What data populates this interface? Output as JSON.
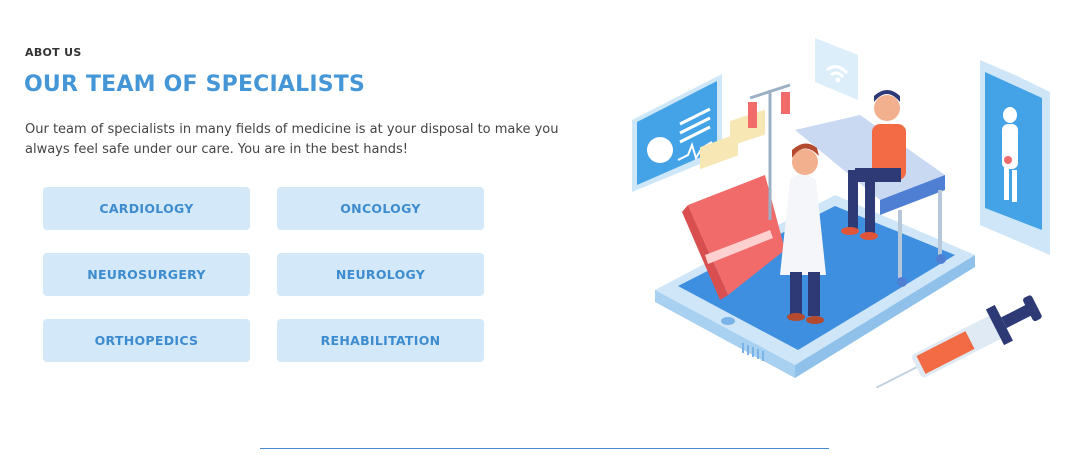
{
  "section": {
    "kicker": "ABOT US",
    "title": "OUR TEAM OF SPECIALISTS",
    "description": "Our team of specialists in many fields of medicine is at your disposal to make you always feel safe under our care. You are in the best hands!"
  },
  "specialties": [
    "CARDIOLOGY",
    "ONCOLOGY",
    "NEUROSURGERY",
    "NEUROLOGY",
    "ORTHOPEDICS",
    "REHABILITATION"
  ],
  "colors": {
    "accent": "#4596d6",
    "button_bg": "#d3e8f8",
    "button_text": "#3d8ccf"
  },
  "illustration": {
    "icons": [
      "tablet-icon",
      "doctor-icon",
      "patient-icon",
      "syringe-icon",
      "wifi-icon",
      "phone-icon",
      "monitor-icon"
    ]
  }
}
